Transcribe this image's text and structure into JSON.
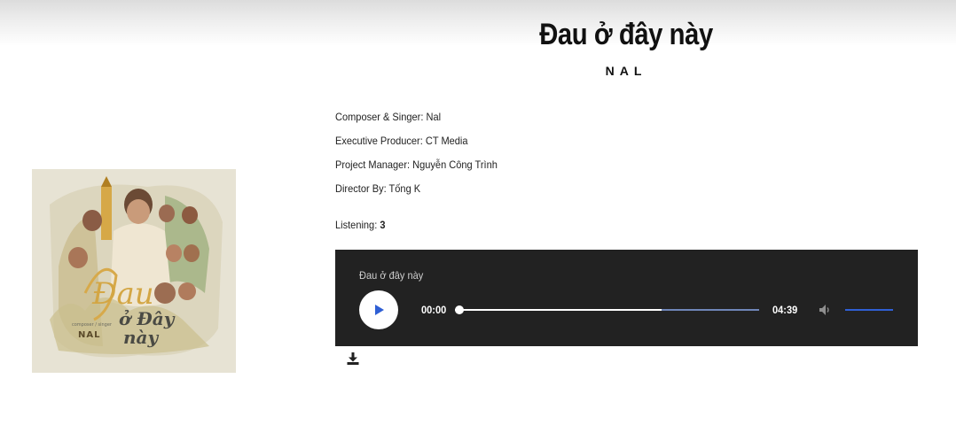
{
  "song": {
    "title": "Đau ở đây này",
    "artist": "NAL"
  },
  "cover": {
    "alt_title_line1": "Đau",
    "alt_title_line2": "ở Đây",
    "alt_title_line3": "này",
    "credit": "composer / singer",
    "artist": "NAL"
  },
  "info": [
    {
      "label": "Composer & Singer:",
      "value": "Nal"
    },
    {
      "label": "Executive Producer:",
      "value": "CT Media"
    },
    {
      "label": "Project Manager:",
      "value": "Nguyễn Công Trình"
    },
    {
      "label": "Director By:",
      "value": "Tống K"
    }
  ],
  "listening": {
    "label": "Listening:",
    "count": "3"
  },
  "player": {
    "track_title": "Đau ở đây này",
    "current_time": "00:00",
    "duration": "04:39",
    "progress": 0,
    "buffered": 0.68,
    "volume": 1.0,
    "play_icon": "play-icon",
    "mute_icon": "speaker-icon",
    "accent_color": "#2f5fd4",
    "background_color": "#222222"
  },
  "download": {
    "icon": "download-icon"
  }
}
